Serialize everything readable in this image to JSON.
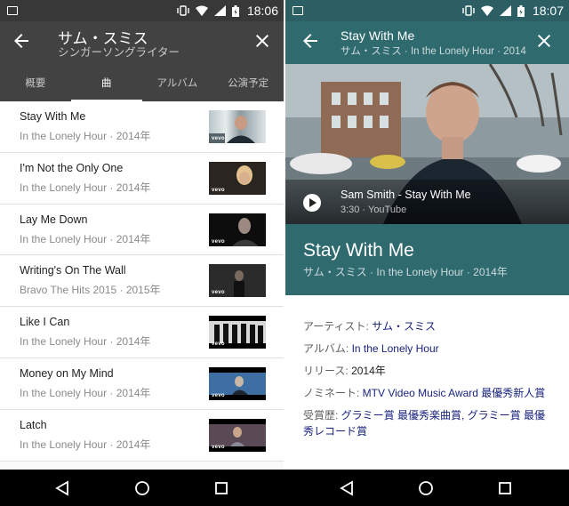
{
  "left": {
    "status": {
      "time": "18:06"
    },
    "header": {
      "title": "サム・スミス",
      "subtitle": "シンガーソングライター"
    },
    "tabs": [
      {
        "label": "概要"
      },
      {
        "label": "曲"
      },
      {
        "label": "アルバム"
      },
      {
        "label": "公演予定"
      }
    ],
    "songs": [
      {
        "title": "Stay With Me",
        "sub": "In the Lonely Hour · 2014年"
      },
      {
        "title": "I'm Not the Only One",
        "sub": "In the Lonely Hour · 2014年"
      },
      {
        "title": "Lay Me Down",
        "sub": "In the Lonely Hour · 2014年"
      },
      {
        "title": "Writing's On The Wall",
        "sub": "Bravo The Hits 2015 · 2015年"
      },
      {
        "title": "Like I Can",
        "sub": "In the Lonely Hour · 2014年"
      },
      {
        "title": "Money on My Mind",
        "sub": "In the Lonely Hour · 2014年"
      },
      {
        "title": "Latch",
        "sub": "In the Lonely Hour · 2014年"
      }
    ],
    "thumb_badge": "vevo"
  },
  "right": {
    "status": {
      "time": "18:07"
    },
    "header": {
      "title": "Stay With Me",
      "subtitle": "サム・スミス · In the Lonely Hour · 2014…"
    },
    "video": {
      "title": "Sam Smith - Stay With Me",
      "duration": "3:30",
      "source": "YouTube",
      "meta": "3:30 · YouTube"
    },
    "info": {
      "title": "Stay With Me",
      "subtitle": "サム・スミス · In the Lonely Hour · 2014年"
    },
    "facts": [
      {
        "label": "アーティスト: ",
        "value": "サム・スミス",
        "link": true
      },
      {
        "label": "アルバム: ",
        "value": "In the Lonely Hour",
        "link": true
      },
      {
        "label": "リリース: ",
        "value": "2014年",
        "link": false
      },
      {
        "label": "ノミネート: ",
        "value": "MTV Video Music Award 最優秀新人賞",
        "link": true
      },
      {
        "label": "受賞歴: ",
        "value": "グラミー賞 最優秀楽曲賞, グラミー賞 最優秀レコード賞",
        "link": true
      }
    ]
  },
  "colors": {
    "left_header": "#424242",
    "right_accent": "#2f6a6f",
    "link": "#1a237e"
  },
  "icons": [
    "back-arrow-icon",
    "close-icon",
    "play-icon",
    "nav-back-icon",
    "nav-home-icon",
    "nav-recents-icon"
  ]
}
